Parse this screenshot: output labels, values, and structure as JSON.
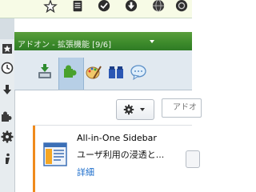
{
  "sidebar": {
    "title": "アドオン - 拡張機能 [9/6]"
  },
  "addons_manager": {
    "search_placeholder": "アドオ",
    "item": {
      "name": "All-in-One Sidebar",
      "description": "ユーザ利用の浸透と...",
      "more_link": "詳細"
    }
  },
  "colors": {
    "titlebar_green": "#3c8a2b",
    "accent_orange": "#f08a1c",
    "link_blue": "#1f6fcc"
  }
}
